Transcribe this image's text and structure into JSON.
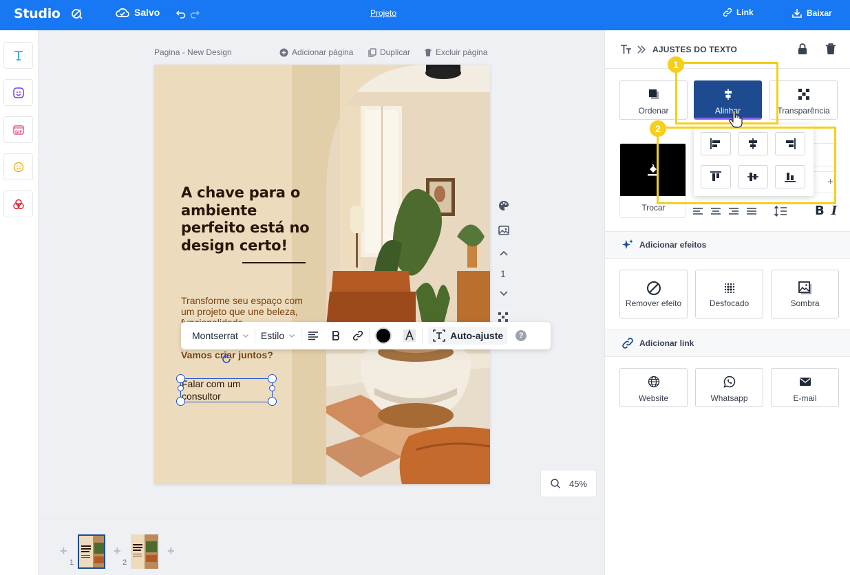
{
  "topbar": {
    "app_name": "Studio",
    "saved_label": "Salvo",
    "project_label": "Projeto",
    "link_label": "Link",
    "download_label": "Baixar"
  },
  "left_tools": [
    {
      "name": "text-tool",
      "icon": "text-icon"
    },
    {
      "name": "sticker-tool",
      "icon": "sticker-icon"
    },
    {
      "name": "gif-tool",
      "icon": "gif-icon"
    },
    {
      "name": "emoji-tool",
      "icon": "emoji-icon"
    },
    {
      "name": "shapes-tool",
      "icon": "shapes-icon"
    }
  ],
  "page_bar": {
    "page_name": "Pagina - New Design",
    "add_page": "Adicionar página",
    "duplicate": "Duplicar",
    "delete_page": "Excluir página"
  },
  "design": {
    "title": "A chave para o ambiente perfeito está no design certo!",
    "subtitle": "Transforme seu espaço com um projeto que une beleza, funcionalidade",
    "question": "Vamos criar juntos?",
    "selected_text": "Falar com um consultor"
  },
  "text_toolbar": {
    "font": "Montserrat",
    "style": "Estilo",
    "auto_fit": "Auto-ajuste",
    "help": "?"
  },
  "page_nav": {
    "page_number": "1"
  },
  "zoom": {
    "value": "45%"
  },
  "thumbnails": [
    {
      "number": "1"
    },
    {
      "number": "2"
    }
  ],
  "panel": {
    "header_title": "AJUSTES DO TEXTO",
    "buttons_row1": [
      {
        "label": "Ordenar"
      },
      {
        "label": "Alinhar"
      },
      {
        "label": "Transparência"
      }
    ],
    "swap_label": "Trocar",
    "effects_title": "Adicionar efeitos",
    "effects": [
      {
        "label": "Remover efeito"
      },
      {
        "label": "Desfocado"
      },
      {
        "label": "Sombra"
      }
    ],
    "link_title": "Adicionar link",
    "links": [
      {
        "label": "Website"
      },
      {
        "label": "Whatsapp"
      },
      {
        "label": "E-mail"
      }
    ]
  },
  "annotations": {
    "badge1": "1",
    "badge2": "2"
  },
  "colors": {
    "primary": "#1877f2",
    "accent": "#1e4b8f",
    "highlight": "#f5cf1c",
    "design_bg": "#ecdcbd"
  }
}
